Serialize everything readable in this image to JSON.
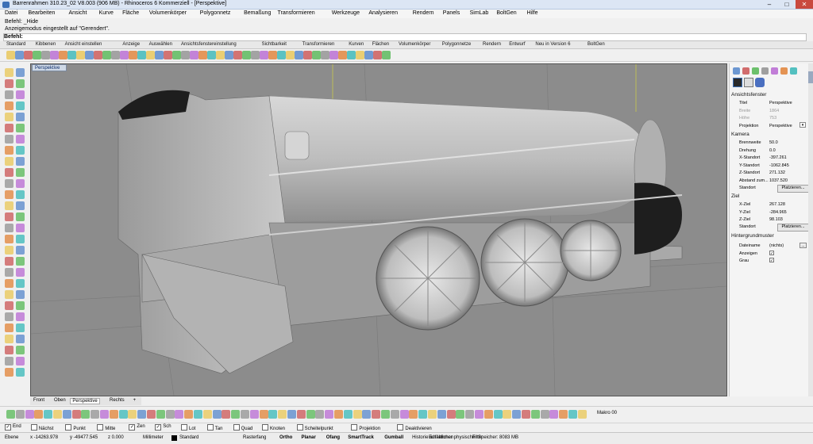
{
  "window": {
    "title": "Barrenrahmen 310.23_02 V8.003 (906 MB) - Rhinoceros 6 Kommerziell - [Perspektive]"
  },
  "menu": [
    "Datei",
    "Bearbeiten",
    "Ansicht",
    "Kurve",
    "Fläche",
    "Volumenkörper",
    "Polygonnetz",
    "Bemaßung",
    "Transformieren",
    "Werkzeuge",
    "Analysieren",
    "Rendern",
    "Panels",
    "SimLab",
    "BoltGen",
    "Hilfe"
  ],
  "command": {
    "line1": "Befehl: _Hide",
    "line2": "Anzeigemodus eingestellt auf \"Gerendert\".",
    "prompt": "Befehl:"
  },
  "toolbar_tabs": [
    "Standard",
    "Kibbenen",
    "Ansicht einstellen",
    "Anzeige",
    "Auswählen",
    "Ansichtsfenstereinstellung",
    "Sichtbarkeit",
    "Transformieren",
    "Kurven",
    "Flächen",
    "Volumenkörper",
    "Polygonnetze",
    "Rendern",
    "Entwurf",
    "Neu in Version 6",
    "BoltGen"
  ],
  "viewport": {
    "active_tab": "Perspektive",
    "bottom_tabs": [
      "Front",
      "Oben",
      "Perspektive",
      "Rechts"
    ]
  },
  "bottom_right_label": "Makro 00",
  "snaps": [
    {
      "label": "End",
      "checked": true
    },
    {
      "label": "Nächst",
      "checked": false
    },
    {
      "label": "Punkt",
      "checked": false
    },
    {
      "label": "Mitte",
      "checked": false
    },
    {
      "label": "Zen",
      "checked": true
    },
    {
      "label": "Sch",
      "checked": true
    },
    {
      "label": "Lot",
      "checked": false
    },
    {
      "label": "Tan",
      "checked": false
    },
    {
      "label": "Quad",
      "checked": false
    },
    {
      "label": "Knoten",
      "checked": false
    },
    {
      "label": "Scheitelpunkt",
      "checked": false
    },
    {
      "label": "Projektion",
      "checked": false
    },
    {
      "label": "Deaktivieren",
      "checked": false
    }
  ],
  "status": {
    "cplane": "Ebene",
    "x": "x -14263.978",
    "y": "y -49477.545",
    "z": "z 0.000",
    "units": "Millimeter",
    "layer": "Standard",
    "items": [
      "Rasterfang",
      "Ortho",
      "Planar",
      "Ofang",
      "SmartTrack",
      "Gumball",
      "Historie aufnehmen",
      "Filter"
    ],
    "bold_items": [
      "Ortho",
      "Planar",
      "Ofang",
      "SmartTrack",
      "Gumball"
    ],
    "memory": "Erhältlicher physischer Speicher: 8083 MB"
  },
  "panel": {
    "section_view": "Ansichtsfenster",
    "view_rows": [
      {
        "k": "Titel",
        "v": "Perspektive",
        "dim": false
      },
      {
        "k": "Breite",
        "v": "1864",
        "dim": true
      },
      {
        "k": "Höhe",
        "v": "753",
        "dim": true
      },
      {
        "k": "Projektion",
        "v": "Perspektive",
        "dim": false
      }
    ],
    "section_camera": "Kamera",
    "camera_rows": [
      {
        "k": "Brennweite",
        "v": "50.0"
      },
      {
        "k": "Drehung",
        "v": "0.0"
      },
      {
        "k": "X-Standort",
        "v": "-397.261"
      },
      {
        "k": "Y-Standort",
        "v": "-1062.845"
      },
      {
        "k": "Z-Standort",
        "v": "271.132"
      },
      {
        "k": "Abstand zum...",
        "v": "1037.520"
      }
    ],
    "camera_place_label": "Standort",
    "place_button": "Platzieren...",
    "section_target": "Ziel",
    "target_rows": [
      {
        "k": "X-Ziel",
        "v": "267.128"
      },
      {
        "k": "Y-Ziel",
        "v": "-284.965"
      },
      {
        "k": "Z-Ziel",
        "v": "98.103"
      }
    ],
    "target_place_label": "Standort",
    "section_bg": "Hintergrundmuster",
    "bg_rows": [
      {
        "k": "Dateiname",
        "v": "(nichts)"
      },
      {
        "k": "Anzeigen",
        "v": ""
      },
      {
        "k": "Grau",
        "v": ""
      }
    ]
  },
  "colors": {
    "viewport_bg": "#8c8c8c",
    "model": "#bdbdbd",
    "accent": "#3b6fb6"
  }
}
